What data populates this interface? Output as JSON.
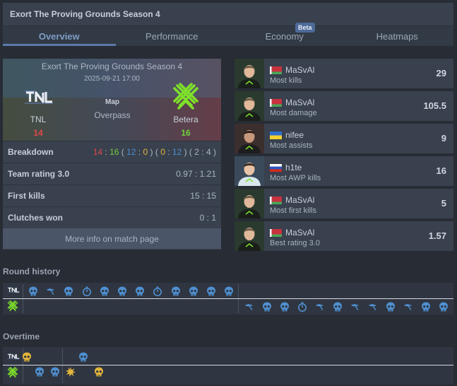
{
  "header": {
    "title": "Exort The Proving Grounds Season 4",
    "tabs": [
      {
        "label": "Overview",
        "active": true
      },
      {
        "label": "Performance"
      },
      {
        "label": "Economy",
        "badge": "Beta"
      },
      {
        "label": "Heatmaps"
      }
    ]
  },
  "match": {
    "event": "Exort The Proving Grounds Season 4",
    "date": "2025-09-21 17:00",
    "map_label": "Map",
    "map": "Overpass",
    "team1": {
      "name": "TNL",
      "score": "14"
    },
    "team2": {
      "name": "Betera",
      "score": "16"
    },
    "rows": [
      {
        "label": "Breakdown"
      },
      {
        "label": "Team rating 3.0",
        "value": "0.97 : 1.21"
      },
      {
        "label": "First kills",
        "value": "15 : 15"
      },
      {
        "label": "Clutches won",
        "value": "0 : 1"
      }
    ],
    "breakdown": {
      "t1": "14",
      "sep1": " : ",
      "t2": "16",
      "p1o": " ( ",
      "h1a": "12",
      "h1s": " : ",
      "h1b": "0",
      "p1c": " ) ",
      "p2o": "( ",
      "h2a": "0",
      "h2s": " : ",
      "h2b": "12",
      "p2c": " ) ",
      "p3o": "( ",
      "ot1": "2",
      "ot_s": " : ",
      "ot2": "4",
      "p3c": " )"
    },
    "more_link": "More info on match page"
  },
  "players": [
    {
      "name": "MaSvAl",
      "flag": "by",
      "stat": "Most kills",
      "value": "29"
    },
    {
      "name": "MaSvAl",
      "flag": "by",
      "stat": "Most damage",
      "value": "105.5"
    },
    {
      "name": "nifee",
      "flag": "ua",
      "stat": "Most assists",
      "value": "9"
    },
    {
      "name": "h1te",
      "flag": "ru",
      "stat": "Most AWP kills",
      "value": "16"
    },
    {
      "name": "MaSvAl",
      "flag": "by",
      "stat": "Most first kills",
      "value": "5"
    },
    {
      "name": "MaSvAl",
      "flag": "by",
      "stat": "Best rating 3.0",
      "value": "1.57"
    }
  ],
  "round_history": {
    "title": "Round history",
    "team1_rounds": [
      "ct-skull",
      "defuse",
      "ct-skull",
      "timer",
      "ct-skull",
      "ct-skull",
      "ct-skull",
      "timer",
      "ct-skull",
      "ct-skull",
      "ct-skull",
      "ct-skull"
    ],
    "team2_rounds": [
      "defuse",
      "ct-skull",
      "ct-skull",
      "timer",
      "defuse",
      "ct-skull",
      "defuse",
      "defuse",
      "ct-skull",
      "defuse",
      "ct-skull",
      "ct-skull",
      "ct-skull"
    ]
  },
  "overtime": {
    "title": "Overtime",
    "team1_rounds": [
      "t-skull",
      "ct-skull"
    ],
    "team2_rounds": [
      "ct-skull",
      "ct-skull",
      "explosion",
      "t-skull"
    ]
  },
  "colors": {
    "ct": "#4f8fd0",
    "t": "#e2b53d",
    "accent": "#5b7aa6",
    "team1": "#e04848",
    "team2": "#6fcf3a"
  }
}
